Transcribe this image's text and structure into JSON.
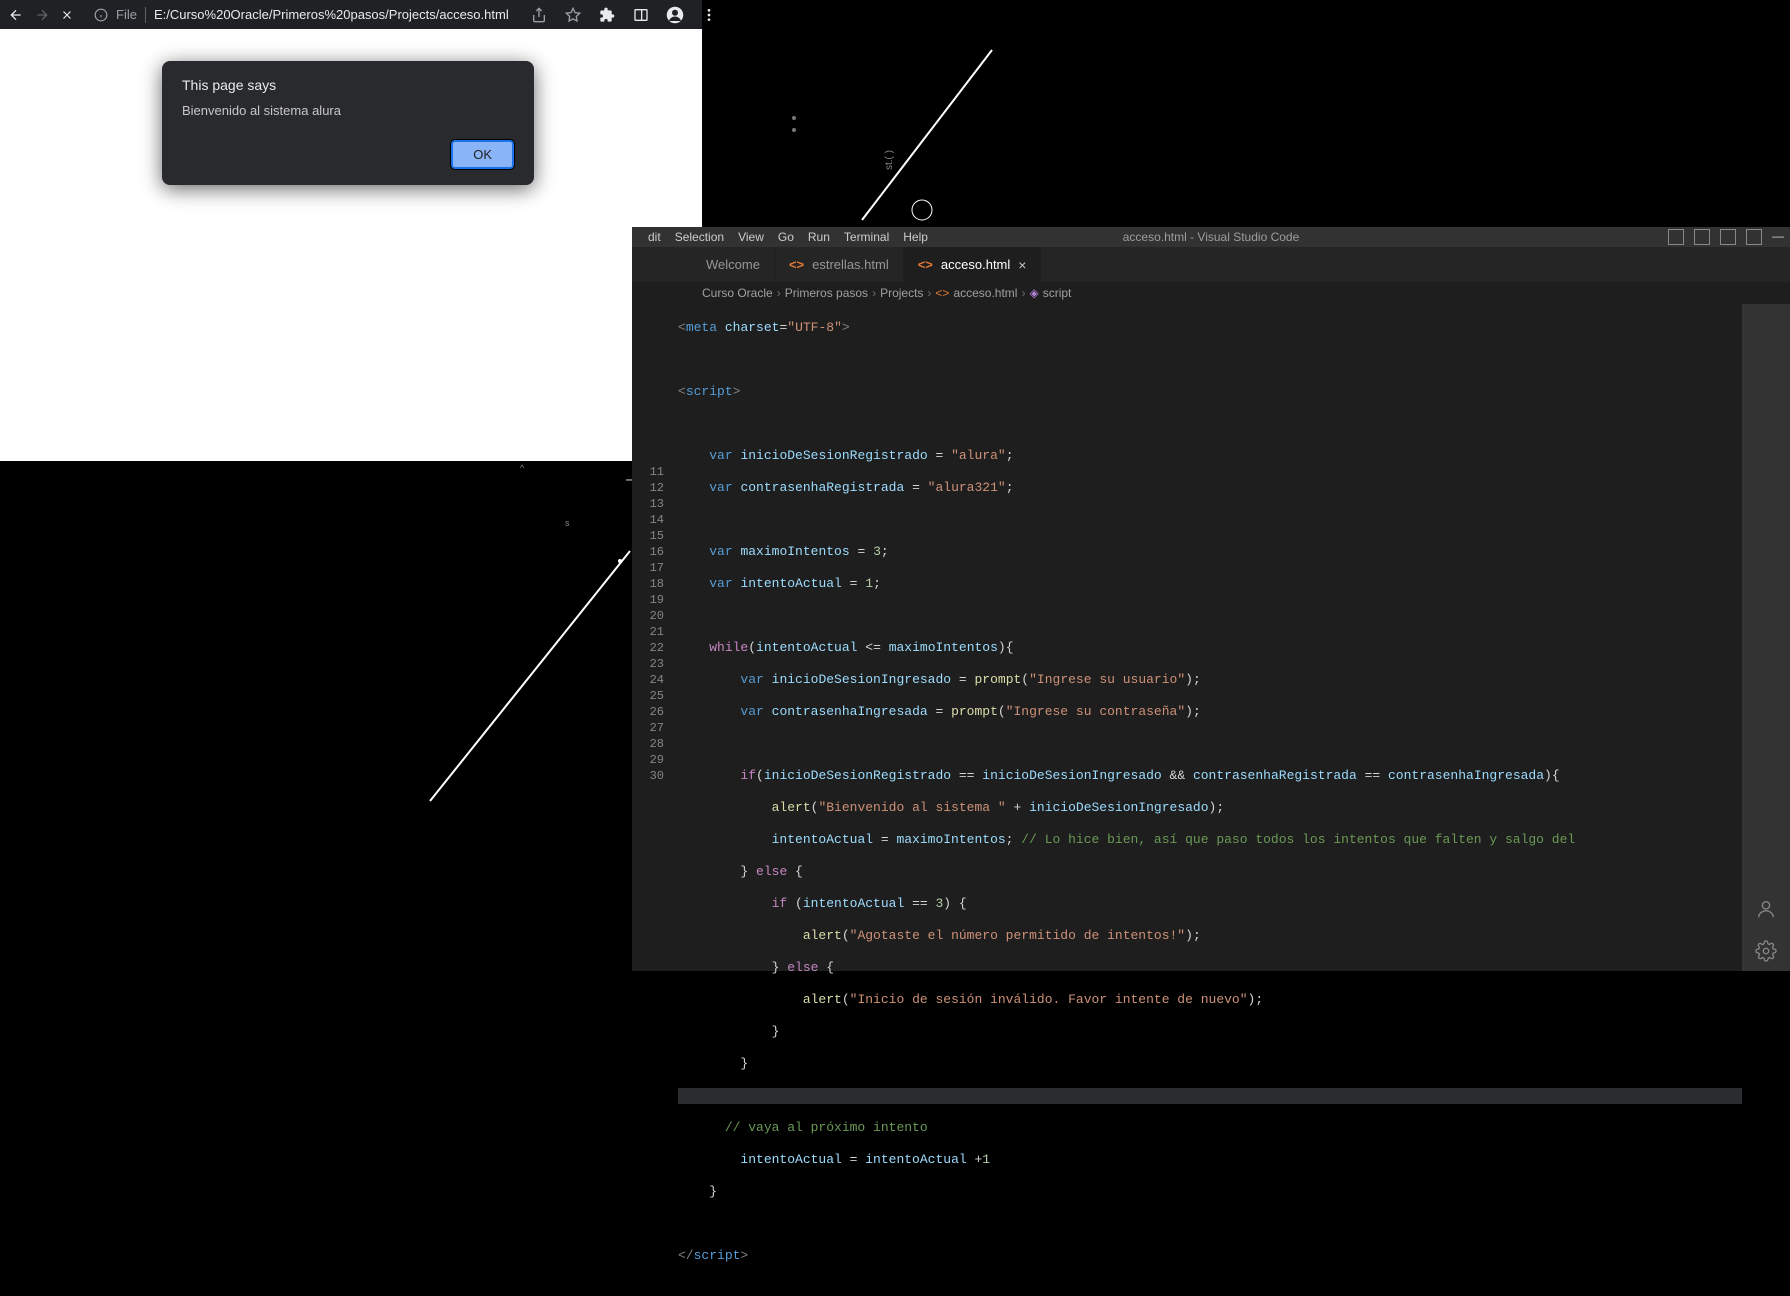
{
  "chrome": {
    "file_label": "File",
    "url": "E:/Curso%20Oracle/Primeros%20pasos/Projects/acceso.html",
    "alert": {
      "title": "This page says",
      "message": "Bienvenido al sistema alura",
      "ok_label": "OK"
    }
  },
  "vscode": {
    "menu": {
      "edit": "dit",
      "selection": "Selection",
      "view": "View",
      "go": "Go",
      "run": "Run",
      "terminal": "Terminal",
      "help": "Help"
    },
    "title": "acceso.html - Visual Studio Code",
    "tabs": {
      "welcome": "Welcome",
      "estrellas": "estrellas.html",
      "acceso": "acceso.html"
    },
    "breadcrumb": {
      "p1": "Curso Oracle",
      "p2": "Primeros pasos",
      "p3": "Projects",
      "file": "acceso.html",
      "symbol": "script"
    },
    "line_numbers": [
      "",
      "",
      "",
      "",
      "",
      "",
      "",
      "",
      "",
      "",
      "11",
      "12",
      "13",
      "14",
      "15",
      "16",
      "17",
      "18",
      "19",
      "20",
      "21",
      "22",
      "23",
      "24",
      "25",
      "26",
      "27",
      "28",
      "29",
      "30"
    ],
    "code": {
      "l1": {
        "meta_open": "<",
        "meta": "meta",
        "sp": " ",
        "attr": "charset",
        "eq": "=",
        "val": "\"UTF-8\"",
        "close": ">"
      },
      "l3": {
        "a": "<",
        "b": "script",
        "c": ">"
      },
      "l5": {
        "kw": "var",
        "name": "inicioDeSesionRegistrado",
        "eq": " = ",
        "val": "\"alura\"",
        "sc": ";"
      },
      "l6": {
        "kw": "var",
        "name": "contrasenhaRegistrada",
        "eq": " = ",
        "val": "\"alura321\"",
        "sc": ";"
      },
      "l8": {
        "kw": "var",
        "name": "maximoIntentos",
        "eq": " = ",
        "val": "3",
        "sc": ";"
      },
      "l9": {
        "kw": "var",
        "name": "intentoActual",
        "eq": " = ",
        "val": "1",
        "sc": ";"
      },
      "l11": {
        "kw": "while",
        "op": "(",
        "v1": "intentoActual",
        "cmp": " <= ",
        "v2": "maximoIntentos",
        "cp": ")",
        "br": "{"
      },
      "l12": {
        "kw": "var",
        "name": "inicioDeSesionIngresado",
        "eq": " = ",
        "fn": "prompt",
        "op": "(",
        "val": "\"Ingrese su usuario\"",
        "cp": ")",
        "sc": ";"
      },
      "l13": {
        "kw": "var",
        "name": "contrasenhaIngresada",
        "eq": " = ",
        "fn": "prompt",
        "op": "(",
        "val": "\"Ingrese su contraseña\"",
        "cp": ")",
        "sc": ";"
      },
      "l15": {
        "kw": "if",
        "op": "(",
        "v1": "inicioDeSesionRegistrado",
        "eq1": " == ",
        "v2": "inicioDeSesionIngresado",
        "and": " && ",
        "v3": "contrasenhaRegistrada",
        "eq2": " == ",
        "v4": "contrasenhaIngresada",
        "cp": ")",
        "br": "{"
      },
      "l16": {
        "fn": "alert",
        "op": "(",
        "val": "\"Bienvenido al sistema \"",
        "plus": " + ",
        "v": "inicioDeSesionIngresado",
        "cp": ")",
        "sc": ";"
      },
      "l17": {
        "v1": "intentoActual",
        "eq": " = ",
        "v2": "maximoIntentos",
        "sc": ";",
        "cmt": " // Lo hice bien, así que paso todos los intentos que falten y salgo del"
      },
      "l18": {
        "br": "}",
        "kw": " else ",
        "ob": "{"
      },
      "l19": {
        "kw": "if ",
        "op": "(",
        "v1": "intentoActual",
        "eq": " == ",
        "val": "3",
        "cp": ")",
        "br": " {"
      },
      "l20": {
        "fn": "alert",
        "op": "(",
        "val": "\"Agotaste el número permitido de intentos!\"",
        "cp": ")",
        "sc": ";"
      },
      "l21": {
        "br": "}",
        "kw": " else ",
        "ob": "{"
      },
      "l22": {
        "fn": "alert",
        "op": "(",
        "val": "\"Inicio de sesión inválido. Favor intente de nuevo\"",
        "cp": ")",
        "sc": ";"
      },
      "l23": {
        "br": "}"
      },
      "l24": {
        "br": "}"
      },
      "l26": {
        "cmt": "// vaya al próximo intento"
      },
      "l27": {
        "v1": "intentoActual",
        "eq": " = ",
        "v2": "intentoActual",
        "plus": " +",
        "val": "1"
      },
      "l28": {
        "br": "}"
      },
      "l30": {
        "a": "</",
        "b": "script",
        "c": ">"
      }
    }
  }
}
